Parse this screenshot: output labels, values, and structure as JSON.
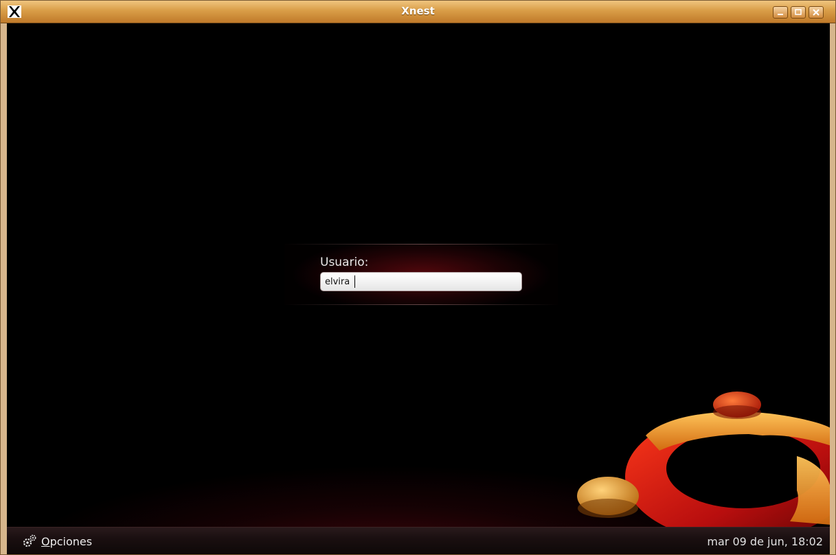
{
  "window": {
    "title": "Xnest"
  },
  "login": {
    "username_label": "Usuario:",
    "username_value": "elvira"
  },
  "taskbar": {
    "options_accel": "O",
    "options_rest": "pciones",
    "clock": "mar 09 de jun, 18:02"
  },
  "icons": {
    "app": "x-logo-icon",
    "minimize": "minimize-icon",
    "maximize": "maximize-icon",
    "close": "close-icon",
    "options": "gears-icon"
  },
  "colors": {
    "titlebar": "#d99d47",
    "background": "#000000",
    "accent": "#e8701a"
  }
}
